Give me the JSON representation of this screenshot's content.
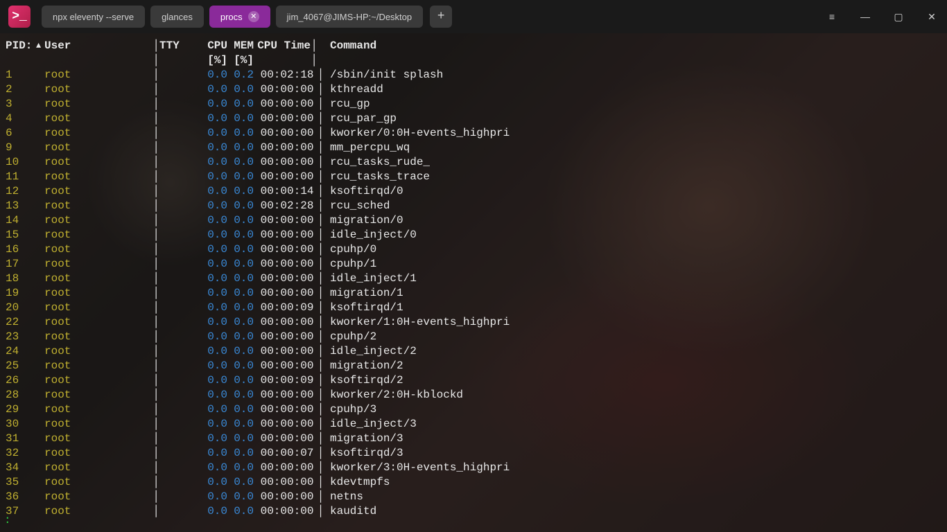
{
  "app": {
    "icon_glyph": ">_"
  },
  "tabs": [
    {
      "label": "npx eleventy --serve",
      "active": false
    },
    {
      "label": "glances",
      "active": false
    },
    {
      "label": "procs",
      "active": true
    },
    {
      "label": "jim_4067@JIMS-HP:~/Desktop",
      "active": false
    }
  ],
  "window": {
    "menu": "≡",
    "min": "—",
    "max": "▢",
    "close": "✕",
    "newtab": "+"
  },
  "headers": {
    "pid": "PID:",
    "sort_glyph": "▲",
    "user": "User",
    "tty": "TTY",
    "cpu": "CPU",
    "mem": "MEM",
    "time": "CPU Time",
    "cmd": "Command",
    "cpu_unit": "[%]",
    "mem_unit": "[%]",
    "separator": "│"
  },
  "prompt": ":",
  "rows": [
    {
      "pid": "1",
      "user": "root",
      "tty": "",
      "cpu": "0.0",
      "mem": "0.2",
      "time": "00:02:18",
      "cmd": "/sbin/init splash"
    },
    {
      "pid": "2",
      "user": "root",
      "tty": "",
      "cpu": "0.0",
      "mem": "0.0",
      "time": "00:00:00",
      "cmd": "kthreadd"
    },
    {
      "pid": "3",
      "user": "root",
      "tty": "",
      "cpu": "0.0",
      "mem": "0.0",
      "time": "00:00:00",
      "cmd": "rcu_gp"
    },
    {
      "pid": "4",
      "user": "root",
      "tty": "",
      "cpu": "0.0",
      "mem": "0.0",
      "time": "00:00:00",
      "cmd": "rcu_par_gp"
    },
    {
      "pid": "6",
      "user": "root",
      "tty": "",
      "cpu": "0.0",
      "mem": "0.0",
      "time": "00:00:00",
      "cmd": "kworker/0:0H-events_highpri"
    },
    {
      "pid": "9",
      "user": "root",
      "tty": "",
      "cpu": "0.0",
      "mem": "0.0",
      "time": "00:00:00",
      "cmd": "mm_percpu_wq"
    },
    {
      "pid": "10",
      "user": "root",
      "tty": "",
      "cpu": "0.0",
      "mem": "0.0",
      "time": "00:00:00",
      "cmd": "rcu_tasks_rude_"
    },
    {
      "pid": "11",
      "user": "root",
      "tty": "",
      "cpu": "0.0",
      "mem": "0.0",
      "time": "00:00:00",
      "cmd": "rcu_tasks_trace"
    },
    {
      "pid": "12",
      "user": "root",
      "tty": "",
      "cpu": "0.0",
      "mem": "0.0",
      "time": "00:00:14",
      "cmd": "ksoftirqd/0"
    },
    {
      "pid": "13",
      "user": "root",
      "tty": "",
      "cpu": "0.0",
      "mem": "0.0",
      "time": "00:02:28",
      "cmd": "rcu_sched"
    },
    {
      "pid": "14",
      "user": "root",
      "tty": "",
      "cpu": "0.0",
      "mem": "0.0",
      "time": "00:00:00",
      "cmd": "migration/0"
    },
    {
      "pid": "15",
      "user": "root",
      "tty": "",
      "cpu": "0.0",
      "mem": "0.0",
      "time": "00:00:00",
      "cmd": "idle_inject/0"
    },
    {
      "pid": "16",
      "user": "root",
      "tty": "",
      "cpu": "0.0",
      "mem": "0.0",
      "time": "00:00:00",
      "cmd": "cpuhp/0"
    },
    {
      "pid": "17",
      "user": "root",
      "tty": "",
      "cpu": "0.0",
      "mem": "0.0",
      "time": "00:00:00",
      "cmd": "cpuhp/1"
    },
    {
      "pid": "18",
      "user": "root",
      "tty": "",
      "cpu": "0.0",
      "mem": "0.0",
      "time": "00:00:00",
      "cmd": "idle_inject/1"
    },
    {
      "pid": "19",
      "user": "root",
      "tty": "",
      "cpu": "0.0",
      "mem": "0.0",
      "time": "00:00:00",
      "cmd": "migration/1"
    },
    {
      "pid": "20",
      "user": "root",
      "tty": "",
      "cpu": "0.0",
      "mem": "0.0",
      "time": "00:00:09",
      "cmd": "ksoftirqd/1"
    },
    {
      "pid": "22",
      "user": "root",
      "tty": "",
      "cpu": "0.0",
      "mem": "0.0",
      "time": "00:00:00",
      "cmd": "kworker/1:0H-events_highpri"
    },
    {
      "pid": "23",
      "user": "root",
      "tty": "",
      "cpu": "0.0",
      "mem": "0.0",
      "time": "00:00:00",
      "cmd": "cpuhp/2"
    },
    {
      "pid": "24",
      "user": "root",
      "tty": "",
      "cpu": "0.0",
      "mem": "0.0",
      "time": "00:00:00",
      "cmd": "idle_inject/2"
    },
    {
      "pid": "25",
      "user": "root",
      "tty": "",
      "cpu": "0.0",
      "mem": "0.0",
      "time": "00:00:00",
      "cmd": "migration/2"
    },
    {
      "pid": "26",
      "user": "root",
      "tty": "",
      "cpu": "0.0",
      "mem": "0.0",
      "time": "00:00:09",
      "cmd": "ksoftirqd/2"
    },
    {
      "pid": "28",
      "user": "root",
      "tty": "",
      "cpu": "0.0",
      "mem": "0.0",
      "time": "00:00:00",
      "cmd": "kworker/2:0H-kblockd"
    },
    {
      "pid": "29",
      "user": "root",
      "tty": "",
      "cpu": "0.0",
      "mem": "0.0",
      "time": "00:00:00",
      "cmd": "cpuhp/3"
    },
    {
      "pid": "30",
      "user": "root",
      "tty": "",
      "cpu": "0.0",
      "mem": "0.0",
      "time": "00:00:00",
      "cmd": "idle_inject/3"
    },
    {
      "pid": "31",
      "user": "root",
      "tty": "",
      "cpu": "0.0",
      "mem": "0.0",
      "time": "00:00:00",
      "cmd": "migration/3"
    },
    {
      "pid": "32",
      "user": "root",
      "tty": "",
      "cpu": "0.0",
      "mem": "0.0",
      "time": "00:00:07",
      "cmd": "ksoftirqd/3"
    },
    {
      "pid": "34",
      "user": "root",
      "tty": "",
      "cpu": "0.0",
      "mem": "0.0",
      "time": "00:00:00",
      "cmd": "kworker/3:0H-events_highpri"
    },
    {
      "pid": "35",
      "user": "root",
      "tty": "",
      "cpu": "0.0",
      "mem": "0.0",
      "time": "00:00:00",
      "cmd": "kdevtmpfs"
    },
    {
      "pid": "36",
      "user": "root",
      "tty": "",
      "cpu": "0.0",
      "mem": "0.0",
      "time": "00:00:00",
      "cmd": "netns"
    },
    {
      "pid": "37",
      "user": "root",
      "tty": "",
      "cpu": "0.0",
      "mem": "0.0",
      "time": "00:00:00",
      "cmd": "kauditd"
    }
  ]
}
